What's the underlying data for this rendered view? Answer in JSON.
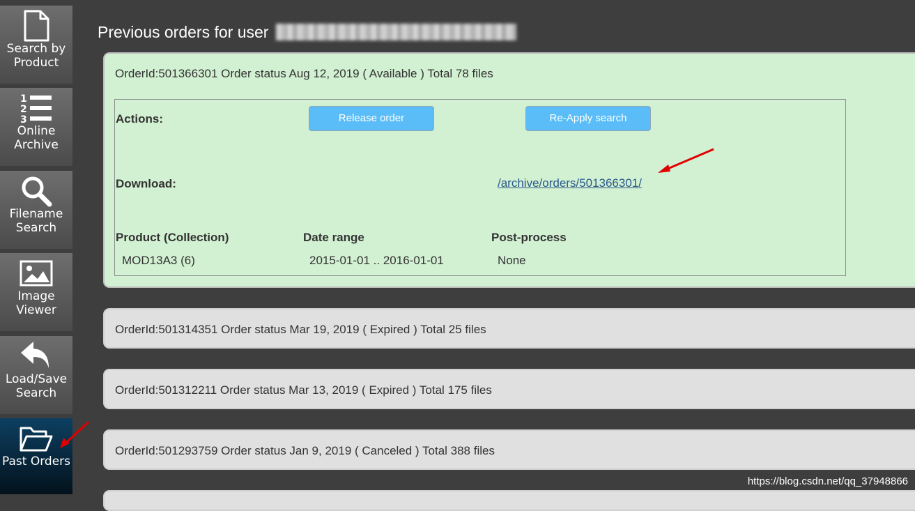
{
  "sidebar": {
    "items": [
      {
        "label": "Search by\nProduct",
        "icon": "document-icon"
      },
      {
        "label": "Online\nArchive",
        "icon": "numbered-list-icon"
      },
      {
        "label": "Filename\nSearch",
        "icon": "search-icon"
      },
      {
        "label": "Image\nViewer",
        "icon": "image-icon"
      },
      {
        "label": "Load/Save\nSearch",
        "icon": "undo-arrow-icon"
      },
      {
        "label": "Past Orders",
        "icon": "folder-open-icon",
        "active": true
      }
    ]
  },
  "main": {
    "title": "Previous orders for user"
  },
  "orders": [
    {
      "header": "OrderId:501366301 Order status Aug 12, 2019 ( Available ) Total 78 files",
      "actions_label": "Actions:",
      "release_button": "Release order",
      "reapply_button": "Re-Apply search",
      "download_label": "Download:",
      "download_link": "/archive/orders/501366301/",
      "columns": [
        "Product (Collection)",
        "Date range",
        "Post-process"
      ],
      "row": [
        "MOD13A3 (6)",
        "2015-01-01 .. 2016-01-01",
        "None"
      ]
    },
    {
      "header": "OrderId:501314351 Order status Mar 19, 2019 ( Expired ) Total 25 files"
    },
    {
      "header": "OrderId:501312211 Order status Mar 13, 2019 ( Expired ) Total 175 files"
    },
    {
      "header": "OrderId:501293759 Order status Jan 9, 2019 ( Canceled ) Total 388 files"
    }
  ],
  "watermark": "https://blog.csdn.net/qq_37948866",
  "colors": {
    "background": "#3e3e3e",
    "open_panel": "#d2f0d2",
    "closed_panel": "#e0e0e0",
    "button": "#5abdf7",
    "active_nav": "#0d3f61",
    "annotation_arrow": "#e00000"
  }
}
